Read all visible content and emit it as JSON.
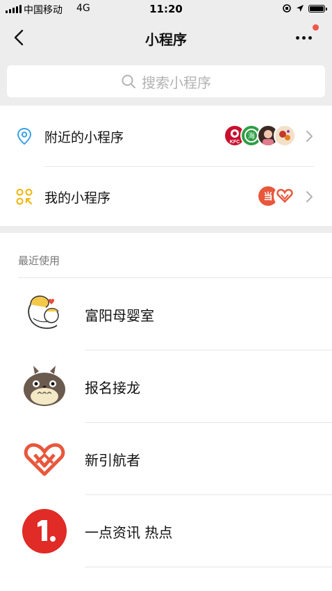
{
  "status_bar": {
    "carrier": "中国移动",
    "network": "4G",
    "time": "11:20"
  },
  "nav": {
    "title": "小程序"
  },
  "search": {
    "placeholder": "搜索小程序"
  },
  "entries": [
    {
      "label": "附近的小程序"
    },
    {
      "label": "我的小程序"
    }
  ],
  "recent": {
    "title": "最近使用",
    "apps": [
      {
        "name": "富阳母婴室"
      },
      {
        "name": "报名接龙"
      },
      {
        "name": "新引航者"
      },
      {
        "name": "一点资讯 热点"
      }
    ]
  },
  "thumb_texts": {
    "kfc": "KFC",
    "hai": "海",
    "me": "当"
  },
  "colors": {
    "accent_blue": "#3aa1ea",
    "accent_yellow": "#f0b400",
    "red": "#e53935",
    "bg_gray": "#ededed"
  }
}
